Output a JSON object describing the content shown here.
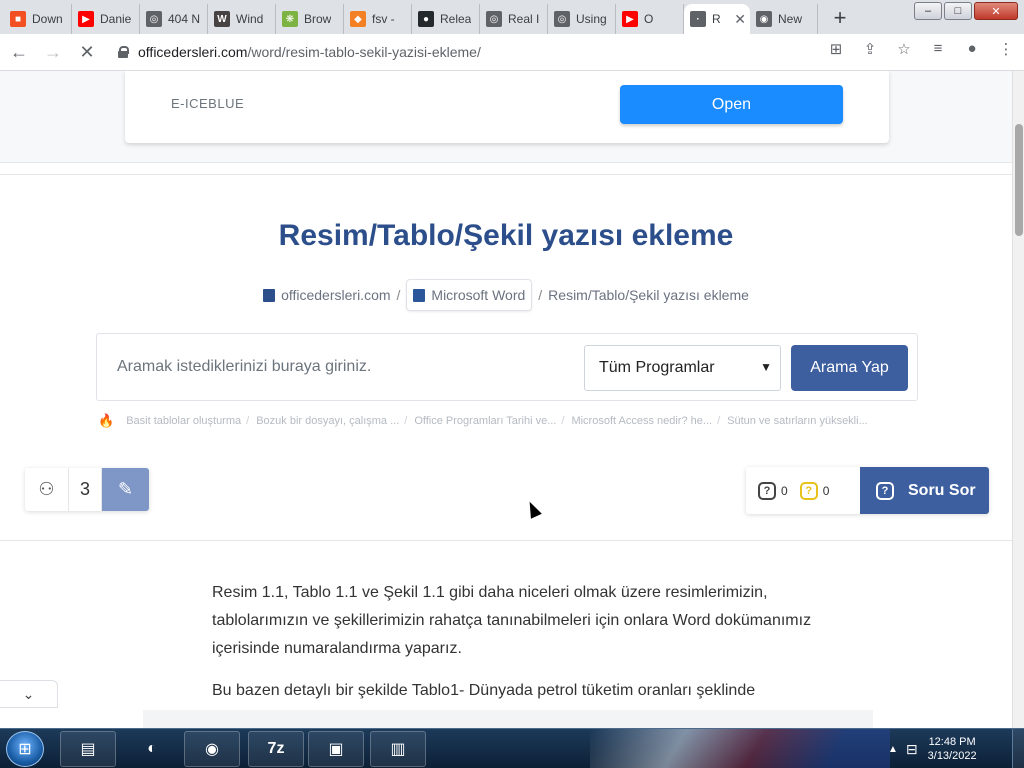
{
  "browser": {
    "tabs": [
      {
        "label": "Down",
        "icon": "windows-icon",
        "color": "#f25022",
        "glyph": "■"
      },
      {
        "label": "Danie",
        "icon": "youtube-icon",
        "color": "#ff0000",
        "glyph": "▶"
      },
      {
        "label": "404 N",
        "icon": "globe-icon",
        "color": "#5f6368",
        "glyph": "◎"
      },
      {
        "label": "Wind",
        "icon": "wordpress-icon",
        "color": "#464342",
        "glyph": "W"
      },
      {
        "label": "Brow",
        "icon": "extension-icon",
        "color": "#7cb342",
        "glyph": "❋"
      },
      {
        "label": "fsv -",
        "icon": "diamond-icon",
        "color": "#f48024",
        "glyph": "◆"
      },
      {
        "label": "Relea",
        "icon": "github-icon",
        "color": "#24292e",
        "glyph": "●"
      },
      {
        "label": "Real I",
        "icon": "globe-icon",
        "color": "#5f6368",
        "glyph": "◎"
      },
      {
        "label": "Using",
        "icon": "globe-icon",
        "color": "#5f6368",
        "glyph": "◎"
      },
      {
        "label": "O",
        "icon": "youtube-icon",
        "color": "#ff0000",
        "glyph": "▶"
      },
      {
        "label": "R",
        "icon": "loading-icon",
        "color": "#5f6368",
        "glyph": "·",
        "active": true
      },
      {
        "label": "New",
        "icon": "chrome-icon",
        "color": "#5f6368",
        "glyph": "◉"
      }
    ],
    "url_domain": "officedersleri.com",
    "url_path": "/word/resim-tablo-sekil-yazisi-ekleme/"
  },
  "ad": {
    "brand": "E-ICEBLUE",
    "button": "Open"
  },
  "page": {
    "title": "Resim/Tablo/Şekil yazısı ekleme",
    "breadcrumb": {
      "home": "officedersleri.com",
      "category": "Microsoft Word",
      "current": "Resim/Tablo/Şekil yazısı ekleme",
      "sep": "/"
    },
    "search": {
      "placeholder": "Aramak istediklerinizi buraya giriniz.",
      "select_value": "Tüm Programlar",
      "button": "Arama Yap"
    },
    "trending": [
      "Basit tablolar oluşturma",
      "Bozuk bir dosyayı, çalışma ...",
      "Office Programları Tarihi ve...",
      "Microsoft Access nedir? he...",
      "Sütun ve satırların yüksekli..."
    ],
    "left_widget": {
      "count": "3"
    },
    "right_widget": {
      "questions_count": "0",
      "answers_count": "0",
      "ask_button": "Soru Sor"
    },
    "paragraphs": [
      "Resim 1.1, Tablo 1.1 ve Şekil 1.1 gibi daha niceleri olmak üzere resimlerimizin, tablolarımızın ve şekillerimizin rahatça tanınabilmeleri için onlara Word dokümanımız içerisinde numaralandırma yaparız.",
      "Bu bazen detaylı bir şekilde Tablo1- Dünyada petrol tüketim oranları şeklinde bazende"
    ]
  },
  "taskbar": {
    "items": [
      "explorer-icon",
      "firefox-icon",
      "chrome-icon",
      "7zip-icon",
      "cmd-icon",
      "monitor-icon"
    ],
    "sevenzip_label": "7z",
    "time": "12:48 PM",
    "date": "3/13/2022"
  },
  "colors": {
    "primary": "#3d5fa0",
    "title": "#2c4e8a",
    "ad_button": "#1a8cff"
  }
}
